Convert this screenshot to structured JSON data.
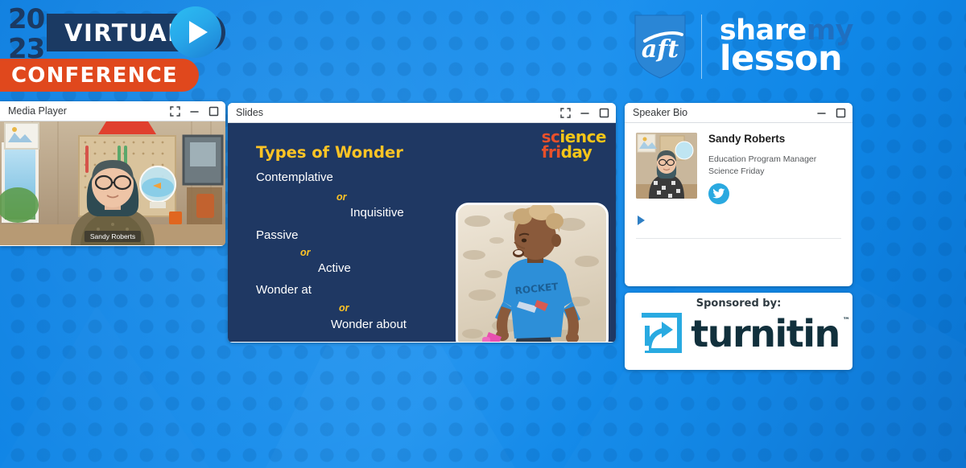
{
  "header": {
    "year": "2023",
    "year_line1": "20",
    "year_line2": "23",
    "virtual_label": "VIRTUAL",
    "conference_label": "CONFERENCE",
    "play_icon": "play-icon",
    "brand": {
      "aft_text": "aft",
      "share": "share",
      "my": "my",
      "lesson": "lesson"
    }
  },
  "media_player": {
    "title": "Media Player",
    "controls": [
      "fullscreen-icon",
      "minimize-icon",
      "maximize-icon"
    ],
    "video_name_label": "Sandy Roberts"
  },
  "slides": {
    "title": "Slides",
    "controls": [
      "fullscreen-icon",
      "minimize-icon",
      "maximize-icon"
    ],
    "slide": {
      "heading": "Types of Wonder",
      "logo": {
        "line1_a": "sc",
        "line1_b": "ience",
        "line2_a": "fri",
        "line2_b": "day"
      },
      "pairs": [
        {
          "left": "Contemplative",
          "conj": "or",
          "right": "Inquisitive"
        },
        {
          "left": "Passive",
          "conj": "or",
          "right": "Active"
        },
        {
          "left": "Wonder at",
          "conj": "or",
          "right": "Wonder about"
        }
      ],
      "photo_alt": "child-on-sand-photo"
    }
  },
  "speaker_bio": {
    "title": "Speaker Bio",
    "controls": [
      "minimize-icon",
      "maximize-icon"
    ],
    "name": "Sandy Roberts",
    "role": "Education Program Manager",
    "organization": "Science Friday",
    "social": "twitter-icon",
    "expand": "play-icon"
  },
  "sponsor": {
    "label": "Sponsored by:",
    "brand": "turnitin",
    "trademark": "™",
    "logo_icon": "turnitin-arrow-icon"
  },
  "colors": {
    "background_blue": "#1288e8",
    "navy": "#1b3a63",
    "orange": "#e0481d",
    "slide_navy": "#1f3863",
    "slide_yellow": "#ffc425",
    "turnitin_cyan": "#29aae1",
    "turnitin_navy": "#11303c",
    "twitter_blue": "#2aa9e0"
  }
}
